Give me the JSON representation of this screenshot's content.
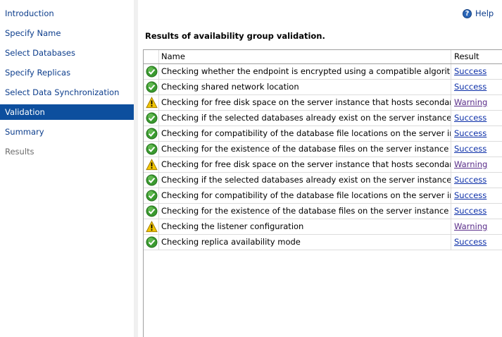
{
  "sidebar": {
    "items": [
      {
        "label": "Introduction",
        "state": "normal"
      },
      {
        "label": "Specify Name",
        "state": "normal"
      },
      {
        "label": "Select Databases",
        "state": "normal"
      },
      {
        "label": "Specify Replicas",
        "state": "normal"
      },
      {
        "label": "Select Data Synchronization",
        "state": "normal"
      },
      {
        "label": "Validation",
        "state": "active"
      },
      {
        "label": "Summary",
        "state": "normal"
      },
      {
        "label": "Results",
        "state": "disabled"
      }
    ]
  },
  "help": {
    "label": "Help",
    "icon": "help-icon"
  },
  "main": {
    "heading": "Results of availability group validation."
  },
  "grid": {
    "columns": [
      "Name",
      "Result"
    ],
    "rows": [
      {
        "status": "success",
        "name": "Checking whether the endpoint is encrypted using a compatible algorithm",
        "result": "Success"
      },
      {
        "status": "success",
        "name": "Checking shared network location",
        "result": "Success"
      },
      {
        "status": "warning",
        "name": "Checking for free disk space on the server instance that hosts secondary re...",
        "result": "Warning"
      },
      {
        "status": "success",
        "name": "Checking if the selected databases already exist on the server instance that ...",
        "result": "Success"
      },
      {
        "status": "success",
        "name": "Checking for compatibility of the database file locations on the server insta...",
        "result": "Success"
      },
      {
        "status": "success",
        "name": "Checking for the existence of the database files on the server instance that ...",
        "result": "Success"
      },
      {
        "status": "warning",
        "name": "Checking for free disk space on the server instance that hosts secondary re...",
        "result": "Warning"
      },
      {
        "status": "success",
        "name": "Checking if the selected databases already exist on the server instance that ...",
        "result": "Success"
      },
      {
        "status": "success",
        "name": "Checking for compatibility of the database file locations on the server insta...",
        "result": "Success"
      },
      {
        "status": "success",
        "name": "Checking for the existence of the database files on the server instance that ...",
        "result": "Success"
      },
      {
        "status": "warning",
        "name": "Checking the listener configuration",
        "result": "Warning"
      },
      {
        "status": "success",
        "name": "Checking replica availability mode",
        "result": "Success"
      }
    ]
  },
  "colors": {
    "active_bg": "#0d4f9e",
    "link": "#0c2fa8",
    "success": "#3a9a2f",
    "warning": "#f2c500"
  }
}
